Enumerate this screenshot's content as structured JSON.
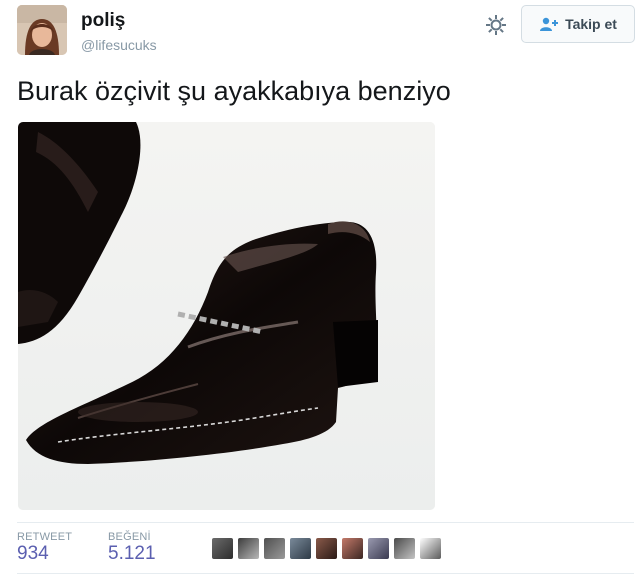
{
  "user": {
    "name": "poliş",
    "handle": "@lifesucuks"
  },
  "follow_button": {
    "label": "Takip et",
    "icon": "add-user-icon"
  },
  "tweet": {
    "text": "Burak özçivit şu ayakkabıya benziyo"
  },
  "media": {
    "description_icon": "shoe-photo"
  },
  "stats": {
    "retweet_label": "RETWEET",
    "retweet_count": "934",
    "like_label": "BEĞENİ",
    "like_count": "5.121"
  },
  "likers_count_shown": 9,
  "colors": {
    "stat_value": "#5b5fb0",
    "muted": "#8899a6",
    "divider": "#e6ecf0"
  }
}
